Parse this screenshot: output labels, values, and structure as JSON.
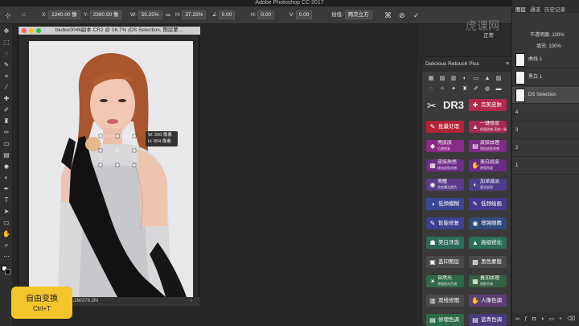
{
  "app": {
    "title": "Adobe Photoshop CC 2017"
  },
  "options_bar": {
    "x_label": "X:",
    "x_value": "2240.00 像",
    "y_label": "Y:",
    "y_value": "2390.50 像",
    "w_label": "W:",
    "w_value": "50.25%",
    "h_label": "H:",
    "h_value": "37.25%",
    "angle_value": "0.00",
    "hskew_label": "H:",
    "hskew_value": "0.00",
    "vskew_label": "V:",
    "vskew_value": "0.00",
    "interp_label": "插值:",
    "interp_value": "两次立方"
  },
  "document": {
    "title": "biubiu0046副本.CR2 @ 16.7% (DS Selection, 图层蒙...",
    "status": "6.1M/378.2M",
    "tooltip_w": "W: 200 像素",
    "tooltip_h": "H: 854 像素"
  },
  "overlay": {
    "line1": "自由变换",
    "line2": "Ctrl+T"
  },
  "plugin": {
    "title": "Delicious Retouch Plus",
    "logo": "DR3",
    "buttons": [
      {
        "t1": "完美皮肤",
        "t2": "",
        "color": "#b2294e",
        "icon": "✚"
      },
      {
        "t1": "批量处理",
        "t2": "",
        "color": "#b52337",
        "icon": "✎"
      },
      {
        "t1": "一键修皮",
        "t2": "保留质感 高度一致",
        "color": "#a52a56",
        "icon": "▲"
      },
      {
        "t1": "亮肌肤",
        "t2": "后期修复",
        "color": "#8a2a87",
        "icon": "◆"
      },
      {
        "t1": "皮肤纹理",
        "t2": "增加皮肤质感",
        "color": "#7d2b84",
        "icon": "▤"
      },
      {
        "t1": "皮肤质感",
        "t2": "增加皮肤质感",
        "color": "#6e2c89",
        "icon": "▦"
      },
      {
        "t1": "美白肌肤",
        "t2": "增强亮度",
        "color": "#6a2c86",
        "icon": "✋"
      },
      {
        "t1": "美瞳",
        "t2": "改变瞳孔颜色",
        "color": "#5a3a8a",
        "icon": "◉"
      },
      {
        "t1": "加深减淡",
        "t2": "柔光加深",
        "color": "#4e3d8c",
        "icon": "◐"
      },
      {
        "t1": "低频模糊",
        "t2": "",
        "color": "#3c4791",
        "icon": "◑"
      },
      {
        "t1": "低频绘画",
        "t2": "",
        "color": "#46398d",
        "icon": "✎"
      },
      {
        "t1": "智能修复",
        "t2": "",
        "color": "#3d3f8f",
        "icon": "✎"
      },
      {
        "t1": "增强眼睛",
        "t2": "",
        "color": "#2f4a7a",
        "icon": "◉"
      },
      {
        "t1": "美白牙齿",
        "t2": "",
        "color": "#2e6a5a",
        "icon": "☗"
      },
      {
        "t1": "高级锐化",
        "t2": "",
        "color": "#2a6e55",
        "icon": "▲"
      },
      {
        "t1": "盖印图层",
        "t2": "",
        "color": "#4a4a4a",
        "icon": "▣"
      },
      {
        "t1": "黑色蒙版",
        "t2": "",
        "color": "#4a4a4a",
        "icon": "▩"
      },
      {
        "t1": "自然光",
        "t2": "增强阳光色调",
        "color": "#2f6a48",
        "icon": "☀"
      },
      {
        "t1": "叠加纹理",
        "t2": "阴影色调",
        "color": "#366042",
        "icon": "▦"
      },
      {
        "t1": "双线修图",
        "t2": "",
        "color": "#4a4a4a",
        "icon": "▥"
      },
      {
        "t1": "人像色调",
        "t2": "",
        "color": "#5d3e74",
        "icon": "✋"
      },
      {
        "t1": "修理色调",
        "t2": "",
        "color": "#2f6b4a",
        "icon": "▤"
      },
      {
        "t1": "蓝青色调",
        "t2": "",
        "color": "#4b3c7e",
        "icon": "▤"
      }
    ]
  },
  "layers_panel": {
    "tab_layers": "图层",
    "tab_channels": "通道",
    "tab_history": "历史记录",
    "blend_label": "正常",
    "opacity_label": "不透明度:",
    "opacity_value": "100%",
    "fill_label": "填充:",
    "fill_value": "100%",
    "watermark": "虎课网",
    "layers": [
      {
        "name": "曲线 1"
      },
      {
        "name": "黑白 1"
      },
      {
        "name": "DS Selection"
      },
      {
        "name": "4"
      },
      {
        "name": "3"
      },
      {
        "name": "2"
      },
      {
        "name": "1"
      }
    ]
  }
}
